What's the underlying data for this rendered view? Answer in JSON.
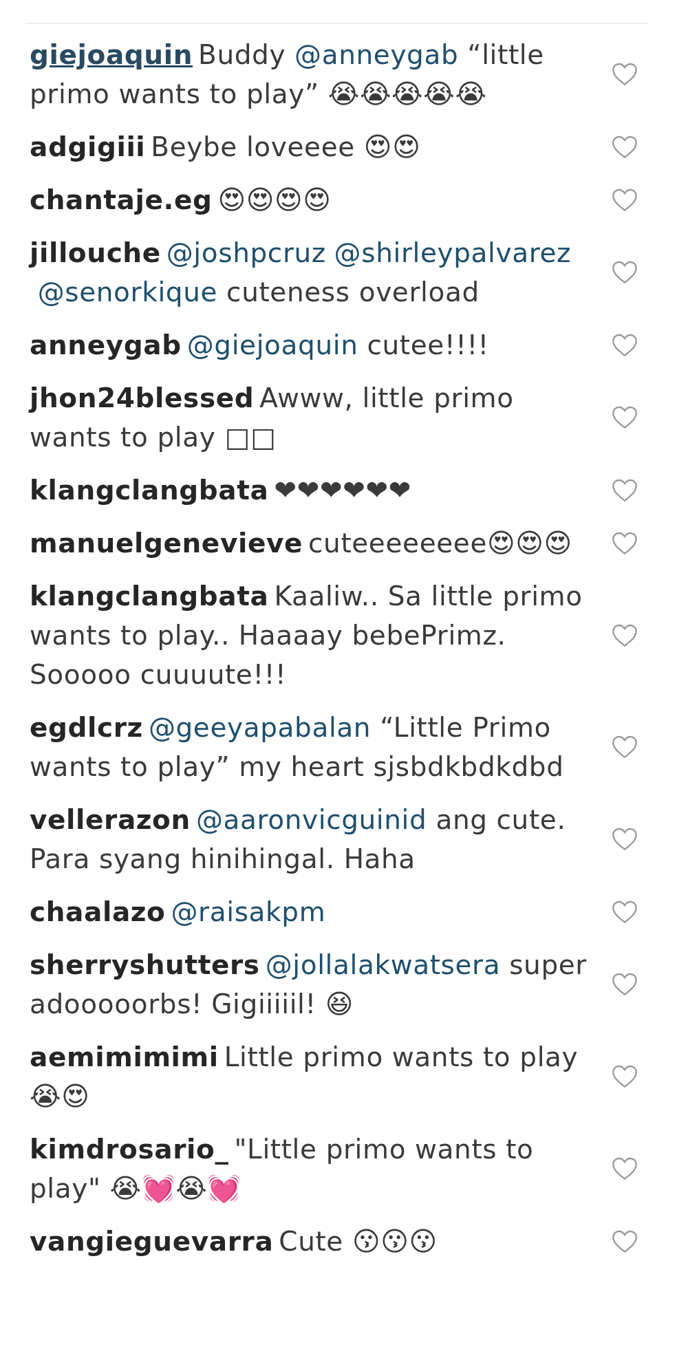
{
  "comments": [
    {
      "username": "giejoaquin",
      "hovered": true,
      "parts": [
        {
          "kind": "text",
          "text": "Buddy "
        },
        {
          "kind": "mention",
          "text": "@anneygab"
        },
        {
          "kind": "text",
          "text": " “little primo wants to play” 😭😭😭😭😭"
        }
      ]
    },
    {
      "username": "adgigiii",
      "hovered": false,
      "parts": [
        {
          "kind": "text",
          "text": "Beybe loveeee 😍😍"
        }
      ]
    },
    {
      "username": "chantaje.eg",
      "hovered": false,
      "parts": [
        {
          "kind": "text",
          "text": "😍😍😍😍"
        }
      ]
    },
    {
      "username": "jillouche",
      "hovered": false,
      "parts": [
        {
          "kind": "mention",
          "text": "@joshpcruz"
        },
        {
          "kind": "mention",
          "text": "@shirleypalvarez"
        },
        {
          "kind": "mention",
          "text": "@senorkique"
        },
        {
          "kind": "text",
          "text": " cuteness overload"
        }
      ]
    },
    {
      "username": "anneygab",
      "hovered": false,
      "parts": [
        {
          "kind": "mention",
          "text": "@giejoaquin"
        },
        {
          "kind": "text",
          "text": " cutee!!!!"
        }
      ]
    },
    {
      "username": "jhon24blessed",
      "hovered": false,
      "parts": [
        {
          "kind": "text",
          "text": "Awww, little primo wants to play □□"
        }
      ]
    },
    {
      "username": "klangclangbata",
      "hovered": false,
      "parts": [
        {
          "kind": "text",
          "text": "❤❤❤❤❤❤"
        }
      ]
    },
    {
      "username": "manuelgenevieve",
      "hovered": false,
      "parts": [
        {
          "kind": "text",
          "text": "cuteeeeeeee😍😍😍"
        }
      ]
    },
    {
      "username": "klangclangbata",
      "hovered": false,
      "parts": [
        {
          "kind": "text",
          "text": "Kaaliw.. Sa little primo wants to play.. Haaaay bebePrimz. Sooooo cuuuute!!!"
        }
      ]
    },
    {
      "username": "egdlcrz",
      "hovered": false,
      "parts": [
        {
          "kind": "mention",
          "text": "@geeyapabalan"
        },
        {
          "kind": "text",
          "text": " “Little Primo wants to play” my heart sjsbdkbdkdbd"
        }
      ]
    },
    {
      "username": "vellerazon",
      "hovered": false,
      "parts": [
        {
          "kind": "mention",
          "text": "@aaronvicguinid"
        },
        {
          "kind": "text",
          "text": " ang cute. Para syang hinihingal. Haha"
        }
      ]
    },
    {
      "username": "chaalazo",
      "hovered": false,
      "parts": [
        {
          "kind": "mention",
          "text": "@raisakpm"
        }
      ]
    },
    {
      "username": "sherryshutters",
      "hovered": false,
      "parts": [
        {
          "kind": "mention",
          "text": "@jollalakwatsera"
        },
        {
          "kind": "text",
          "text": " super adooooorbs! Gigiiiiil! 😆"
        }
      ]
    },
    {
      "username": "aemimimimi",
      "hovered": false,
      "parts": [
        {
          "kind": "text",
          "text": "Little primo wants to play 😭😍"
        }
      ]
    },
    {
      "username": "kimdrosario_",
      "hovered": false,
      "parts": [
        {
          "kind": "text",
          "text": "\"Little primo wants to play\" 😭💓😭💓"
        }
      ]
    },
    {
      "username": "vangieguevarra",
      "hovered": false,
      "parts": [
        {
          "kind": "text",
          "text": "Cute 😗😗😗"
        }
      ]
    }
  ]
}
